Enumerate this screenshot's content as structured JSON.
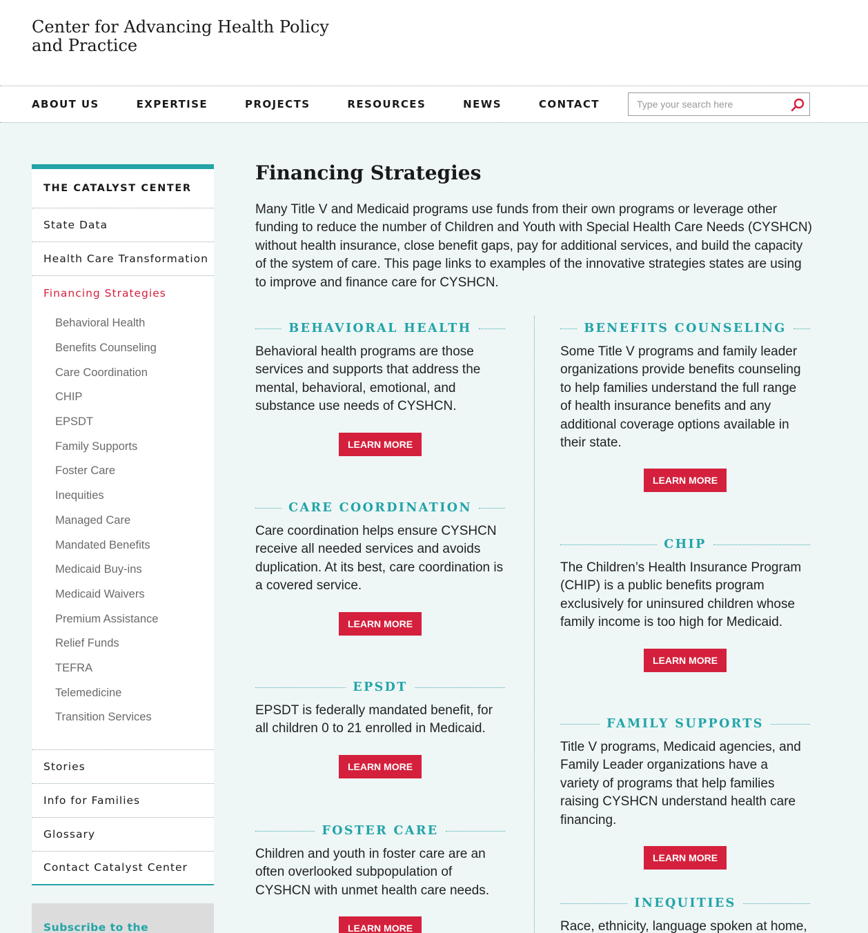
{
  "site": {
    "title": "Center for Advancing Health Policy and Practice"
  },
  "nav": {
    "items": [
      "ABOUT US",
      "EXPERTISE",
      "PROJECTS",
      "RESOURCES",
      "NEWS",
      "CONTACT"
    ]
  },
  "search": {
    "placeholder": "Type your search here",
    "value": "",
    "icon": "search-icon"
  },
  "sidebar": {
    "heading": "THE CATALYST CENTER",
    "items_top": [
      "State Data",
      "Health Care Transformation"
    ],
    "active": "Financing Strategies",
    "subitems": [
      "Behavioral Health",
      "Benefits Counseling",
      "Care Coordination",
      "CHIP",
      "EPSDT",
      "Family Supports",
      "Foster Care",
      "Inequities",
      "Managed Care",
      "Mandated Benefits",
      "Medicaid Buy-ins",
      "Medicaid Waivers",
      "Premium Assistance",
      "Relief Funds",
      "TEFRA",
      "Telemedicine",
      "Transition Services"
    ],
    "items_bottom": [
      "Stories",
      "Info for Families",
      "Glossary",
      "Contact Catalyst Center"
    ],
    "subscribe": "Subscribe to the Catalyst mailing list »"
  },
  "main": {
    "title": "Financing Strategies",
    "intro": "Many Title V and Medicaid programs use funds from their own programs or leverage other funding to reduce the number of Children and Youth with Special Health Care Needs (CYSHCN) without health insurance, close benefit gaps, pay for additional services, and build the capacity of the system of care. This page links to examples of the innovative strategies states are using to improve and finance care for CYSHCN.",
    "button_label": "LEARN MORE",
    "left_cards": [
      {
        "heading": "BEHAVIORAL HEALTH",
        "text": "Behavioral health programs are those services and supports that address the mental, behavioral, emotional, and substance use needs of CYSHCN."
      },
      {
        "heading": "CARE COORDINATION",
        "text": "Care coordination helps ensure CYSHCN receive all needed services and avoids duplication. At its best, care coordination is a covered service."
      },
      {
        "heading": "EPSDT",
        "text": "EPSDT is federally mandated benefit, for all children 0 to 21 enrolled in Medicaid."
      },
      {
        "heading": "FOSTER CARE",
        "text": "Children and youth in foster care are an often overlooked subpopulation of CYSHCN with unmet health care needs."
      }
    ],
    "right_cards": [
      {
        "heading": "BENEFITS COUNSELING",
        "text": "Some Title V programs and family leader organizations provide benefits counseling to help families understand the full range of health insurance benefits and any additional coverage options available in their state."
      },
      {
        "heading": "CHIP",
        "text": "The Children’s Health Insurance Program (CHIP) is a public benefits program exclusively for uninsured children whose family income is too high for Medicaid."
      },
      {
        "heading": "FAMILY SUPPORTS",
        "text": "Title V programs, Medicaid agencies, and Family Leader organizations have a variety of programs that help families raising CYSHCN understand health care financing."
      },
      {
        "heading": "INEQUITIES",
        "text": "Race, ethnicity, language spoken at home,"
      }
    ]
  },
  "colors": {
    "accent": "#23a4a8",
    "button": "#d4203c",
    "active": "#d4203c",
    "background": "#eef6f6"
  }
}
